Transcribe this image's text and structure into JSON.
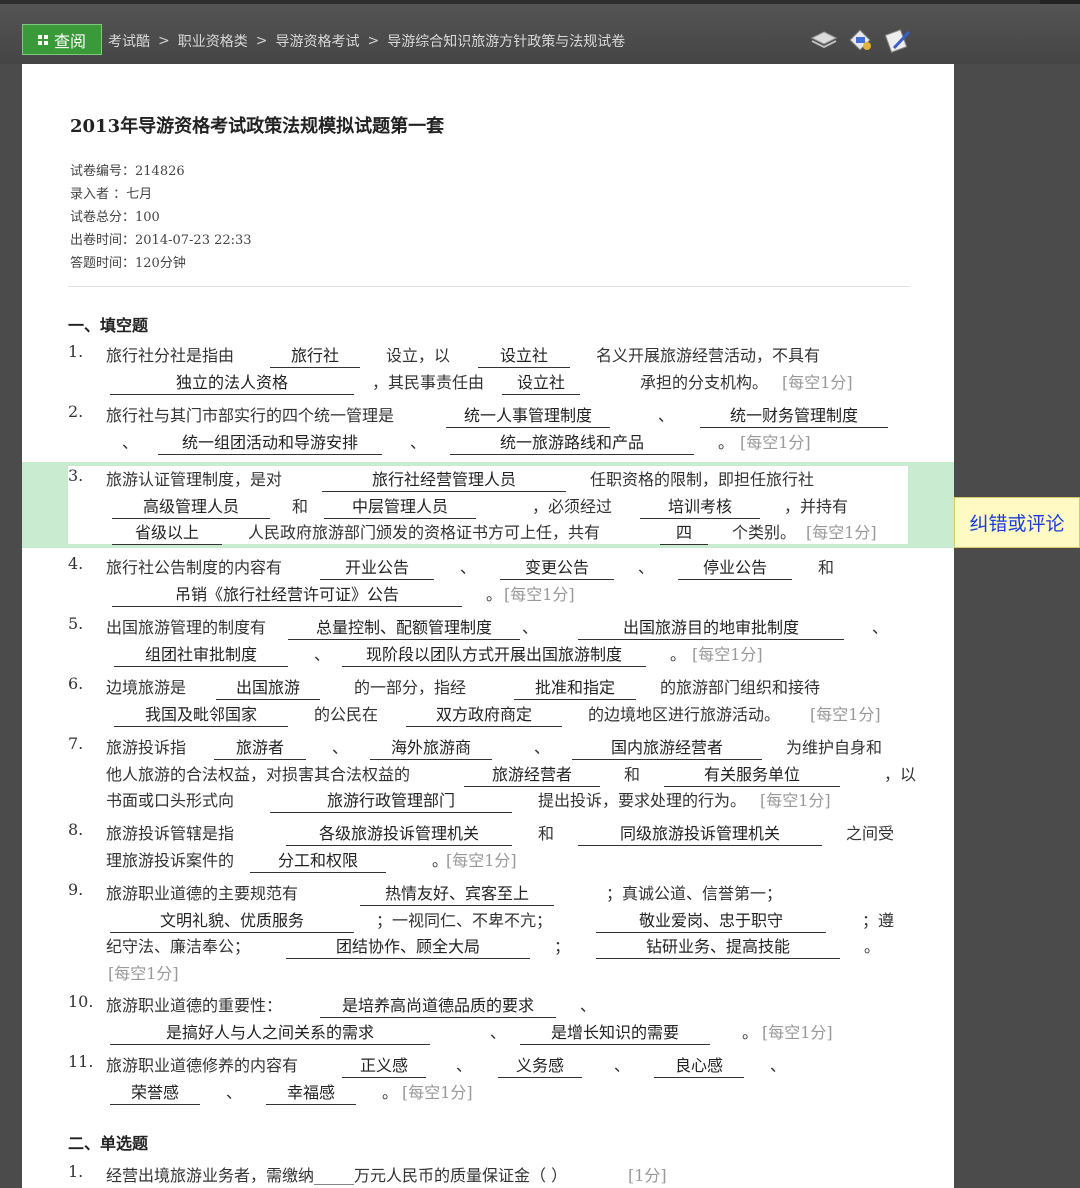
{
  "topbar": {
    "logo_label": "查阅",
    "breadcrumb": [
      "考试酷",
      "职业资格类",
      "导游资格考试",
      "导游综合知识旅游方针政策与法规试卷"
    ],
    "separator": ">",
    "tools": [
      "stack-icon",
      "paint-icon",
      "edit-icon"
    ]
  },
  "exam": {
    "title": "2013年导游资格考试政策法规模拟试题第一套",
    "meta": [
      {
        "label": "试卷编号：",
        "value": "214826"
      },
      {
        "label": "录入者  ：",
        "value": "七月"
      },
      {
        "label": "试卷总分：",
        "value": "100"
      },
      {
        "label": "出卷时间：",
        "value": "2014-07-23   22:33"
      },
      {
        "label": "答题时间：",
        "value": "120分钟"
      }
    ]
  },
  "sections": {
    "fill_title": "一、填空题",
    "single_title": "二、单选题"
  },
  "points_each": "[每空1分]",
  "questions": [
    {
      "num": "1.",
      "lines": [
        [
          "旅行社分社是指由",
          {
            "a": "旅行社"
          },
          "设立，以",
          {
            "a": "设立社"
          },
          "名义开展旅游经营活动，不具有"
        ],
        [
          {
            "a": "独立的法人资格"
          },
          "，其民事责任由",
          {
            "a": "设立社"
          },
          "承担的分支机构。"
        ]
      ]
    },
    {
      "num": "2.",
      "lines": [
        [
          "旅行社与其门市部实行的四个统一管理是",
          {
            "a": "统一人事管理制度"
          },
          "、",
          {
            "a": "统一财务管理制度"
          }
        ],
        [
          "、",
          {
            "a": "统一组团活动和导游安排"
          },
          "、",
          {
            "a": "统一旅游路线和产品"
          },
          "。"
        ]
      ]
    },
    {
      "num": "3.",
      "lines": [
        [
          "旅游认证管理制度，是对",
          {
            "a": "旅行社经营管理人员"
          },
          "任职资格的限制，即担任旅行社"
        ],
        [
          {
            "a": "高级管理人员"
          },
          "和",
          {
            "a": "中层管理人员"
          },
          "，必须经过",
          {
            "a": "培训考核"
          },
          "，并持有"
        ],
        [
          {
            "a": "省级以上"
          },
          "人民政府旅游部门颁发的资格证书方可上任，共有",
          {
            "a": "四"
          },
          "个类别。"
        ]
      ]
    },
    {
      "num": "4.",
      "lines": [
        [
          "旅行社公告制度的内容有",
          {
            "a": "开业公告"
          },
          "、",
          {
            "a": "变更公告"
          },
          "、",
          {
            "a": "停业公告"
          },
          "和"
        ],
        [
          {
            "a": "吊销《旅行社经营许可证》公告"
          },
          "。"
        ]
      ]
    },
    {
      "num": "5.",
      "lines": [
        [
          "出国旅游管理的制度有",
          {
            "a": "总量控制、配额管理制度"
          },
          "、",
          {
            "a": "出国旅游目的地审批制度"
          },
          "、"
        ],
        [
          {
            "a": "组团社审批制度"
          },
          "、",
          {
            "a": "现阶段以团队方式开展出国旅游制度"
          },
          "。"
        ]
      ]
    },
    {
      "num": "6.",
      "lines": [
        [
          "边境旅游是",
          {
            "a": "出国旅游"
          },
          "的一部分，指经",
          {
            "a": "批准和指定"
          },
          "的旅游部门组织和接待"
        ],
        [
          {
            "a": "我国及毗邻国家"
          },
          "的公民在",
          {
            "a": "双方政府商定"
          },
          "的边境地区进行旅游活动。"
        ]
      ]
    },
    {
      "num": "7.",
      "lines": [
        [
          "旅游投诉指",
          {
            "a": "旅游者"
          },
          "、",
          {
            "a": "海外旅游商"
          },
          "、",
          {
            "a": "国内旅游经营者"
          },
          "为维护自身和"
        ],
        [
          "他人旅游的合法权益，对损害其合法权益的",
          {
            "a": "旅游经营者"
          },
          "和",
          {
            "a": "有关服务单位"
          },
          "，以"
        ],
        [
          "书面或口头形式向",
          {
            "a": "旅游行政管理部门"
          },
          "提出投诉，要求处理的行为。"
        ]
      ]
    },
    {
      "num": "8.",
      "lines": [
        [
          "旅游投诉管辖是指",
          {
            "a": "各级旅游投诉管理机关"
          },
          "和",
          {
            "a": "同级旅游投诉管理机关"
          },
          "之间受"
        ],
        [
          "理旅游投诉案件的",
          {
            "a": "分工和权限"
          },
          "。"
        ]
      ]
    },
    {
      "num": "9.",
      "lines": [
        [
          "旅游职业道德的主要规范有",
          {
            "a": "热情友好、宾客至上"
          },
          "；真诚公道、信誉第一；"
        ],
        [
          {
            "a": "文明礼貌、优质服务"
          },
          "；一视同仁、不卑不亢；",
          {
            "a": "敬业爱岗、忠于职守"
          },
          "；遵"
        ],
        [
          "纪守法、廉洁奉公；",
          {
            "a": "团结协作、顾全大局"
          },
          "；",
          {
            "a": "钻研业务、提高技能"
          },
          "。"
        ],
        []
      ]
    },
    {
      "num": "10.",
      "lines": [
        [
          "旅游职业道德的重要性：",
          {
            "a": "是培养高尚道德品质的要求"
          },
          "、"
        ],
        [
          {
            "a": "是搞好人与人之间关系的需求"
          },
          "、",
          {
            "a": "是增长知识的需要"
          },
          "。"
        ]
      ]
    },
    {
      "num": "11.",
      "lines": [
        [
          "旅游职业道德修养的内容有",
          {
            "a": "正义感"
          },
          "、",
          {
            "a": "义务感"
          },
          "、",
          {
            "a": "良心感"
          },
          "、"
        ],
        [
          {
            "a": "荣誉感"
          },
          "、",
          {
            "a": "幸福感"
          },
          "。"
        ]
      ]
    }
  ],
  "single_choice": [
    {
      "num": "1.",
      "text": "经营出境旅游业务者，需缴纳_____万元人民币的质量保证金（   ）",
      "points": "[1分]"
    }
  ],
  "correction_button": "纠错或评论"
}
